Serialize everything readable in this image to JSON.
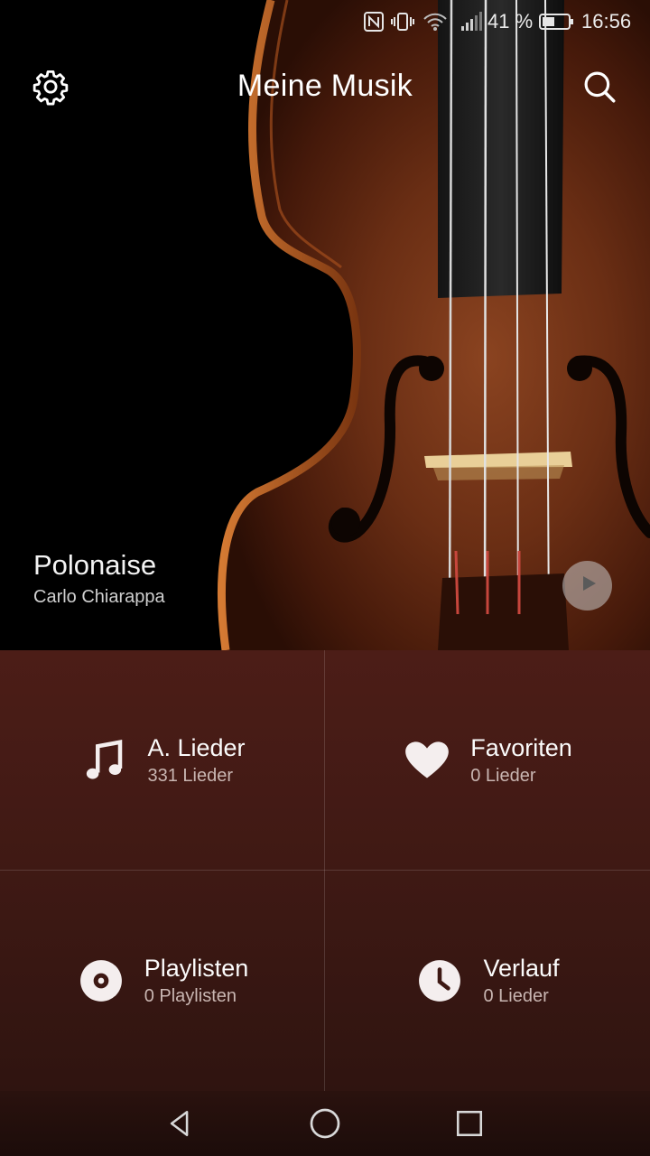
{
  "status_bar": {
    "battery_percent": "41 %",
    "time": "16:56",
    "icons": [
      "nfc-icon",
      "vibrate-icon",
      "wifi-icon",
      "signal-icon",
      "battery-icon"
    ]
  },
  "app_bar": {
    "title": "Meine Musik",
    "left_icon": "settings-gear-icon",
    "right_icon": "search-icon"
  },
  "now_playing": {
    "title": "Polonaise",
    "artist": "Carlo Chiarappa",
    "play_icon": "play-icon"
  },
  "tiles": [
    {
      "label": "A. Lieder",
      "count": "331 Lieder",
      "icon": "music-note-icon"
    },
    {
      "label": "Favoriten",
      "count": "0 Lieder",
      "icon": "heart-icon"
    },
    {
      "label": "Playlisten",
      "count": "0 Playlisten",
      "icon": "disc-icon"
    },
    {
      "label": "Verlauf",
      "count": "0 Lieder",
      "icon": "clock-icon"
    }
  ],
  "nav_bar": {
    "buttons": [
      "back-icon",
      "home-icon",
      "recents-icon"
    ]
  },
  "colors": {
    "tile_background": "#451b15",
    "nav_background": "#1f0d0a",
    "accent_text": "#ffffff"
  }
}
